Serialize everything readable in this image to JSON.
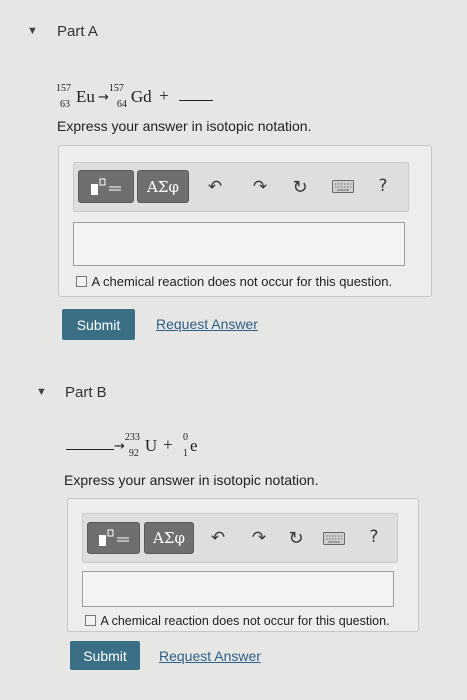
{
  "partA": {
    "title": "Part A",
    "toggle_icon": "triangle-down",
    "equation": {
      "reactant": {
        "mass": "157",
        "atomic": "63",
        "symbol": "Eu"
      },
      "arrow": "→",
      "product": {
        "mass": "157",
        "atomic": "64",
        "symbol": "Gd"
      },
      "plus": "+"
    },
    "instruction": "Express your answer in isotopic notation.",
    "toolbar": {
      "greek_label": "ΑΣφ",
      "help_label": "?"
    },
    "checkbox_label": "A chemical reaction does not occur for this question.",
    "submit_label": "Submit",
    "request_label": "Request Answer"
  },
  "partB": {
    "title": "Part B",
    "toggle_icon": "triangle-down",
    "equation": {
      "arrow": "→",
      "product1": {
        "mass": "233",
        "atomic": "92",
        "symbol": "U"
      },
      "plus": "+",
      "product2": {
        "mass": "0",
        "atomic": "1",
        "symbol": "e"
      }
    },
    "instruction": "Express your answer in isotopic notation.",
    "toolbar": {
      "greek_label": "ΑΣφ",
      "help_label": "?"
    },
    "checkbox_label": "A chemical reaction does not occur for this question.",
    "submit_label": "Submit",
    "request_label": "Request Answer"
  },
  "colors": {
    "submit_bg": "#3a6f86",
    "link": "#2e5f86",
    "tool_btn": "#6f6f6f"
  }
}
